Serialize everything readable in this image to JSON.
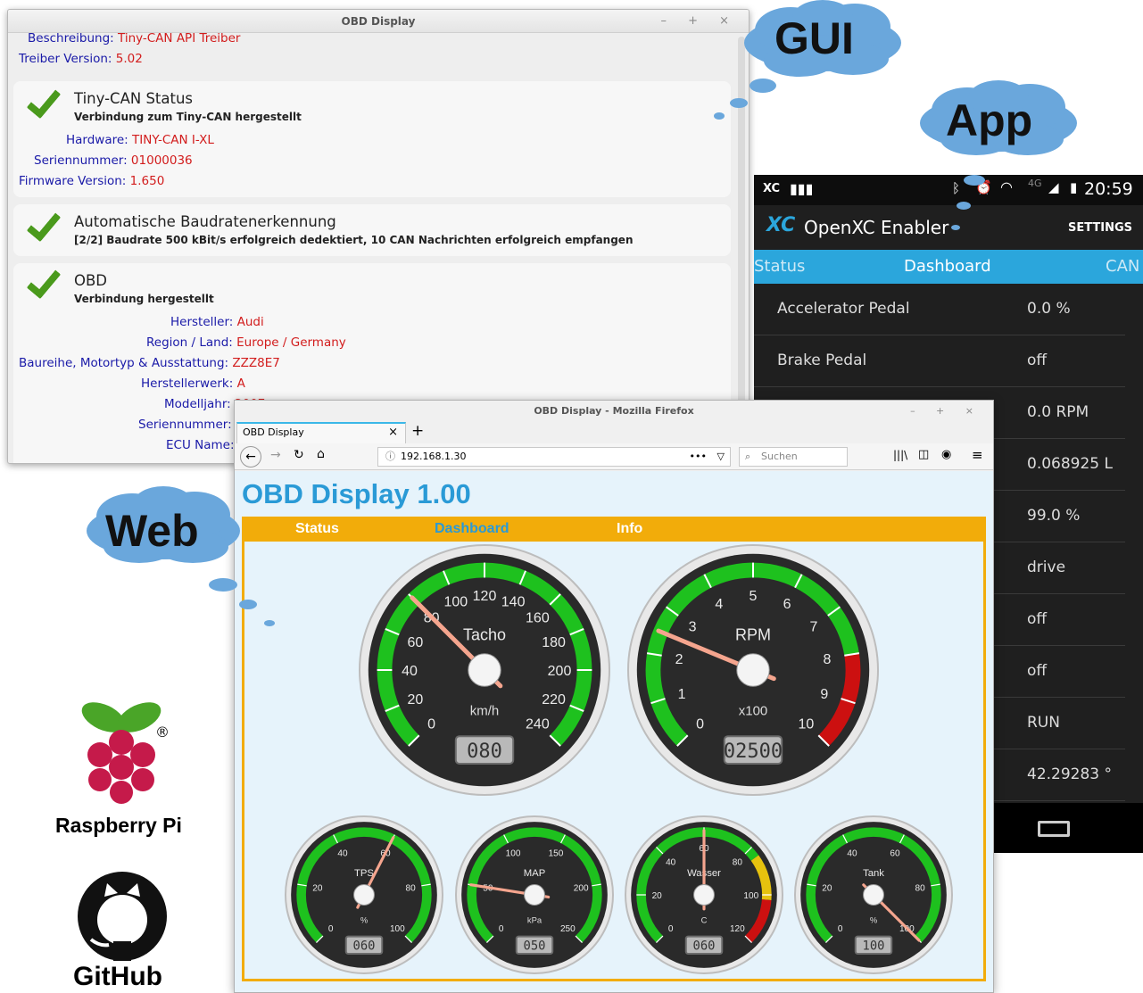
{
  "clouds": {
    "gui": "GUI",
    "app": "App",
    "web": "Web"
  },
  "logos": {
    "raspberry": "Raspberry Pi",
    "github": "GitHub"
  },
  "gui": {
    "title": "OBD Display",
    "top_rows": [
      {
        "key": "Beschreibung:",
        "value": "Tiny-CAN API Treiber"
      },
      {
        "key": "Treiber Version:",
        "value": "5.02"
      }
    ],
    "cards": [
      {
        "title": "Tiny-CAN Status",
        "subtitle": "Verbindung zum Tiny-CAN hergestellt",
        "rows": [
          {
            "key": "Hardware:",
            "value": "TINY-CAN I-XL"
          },
          {
            "key": "Seriennummer:",
            "value": "01000036"
          },
          {
            "key": "Firmware Version:",
            "value": "1.650"
          }
        ]
      },
      {
        "title": "Automatische Baudratenerkennung",
        "subtitle": "[2/2] Baudrate 500 kBit/s erfolgreich dedektiert, 10 CAN Nachrichten erfolgreich empfangen"
      },
      {
        "title": "OBD",
        "subtitle": "Verbindung hergestellt",
        "rows": [
          {
            "key": "Hersteller:",
            "value": "Audi"
          },
          {
            "key": "Region / Land:",
            "value": "Europe / Germany"
          },
          {
            "key": "Baureihe, Motortyp & Ausstattung:",
            "value": "ZZZ8E7"
          },
          {
            "key": "Herstellerwerk:",
            "value": "A"
          },
          {
            "key": "Modelljahr:",
            "value": "2007"
          },
          {
            "key": "Seriennummer:",
            "value": ""
          },
          {
            "key": "ECU Name:",
            "value": ""
          }
        ]
      }
    ]
  },
  "phone": {
    "status": {
      "carrier": "XC",
      "network": "4G",
      "time": "20:59"
    },
    "app_title": "OpenXC Enabler",
    "settings": "SETTINGS",
    "tabs": [
      "Status",
      "Dashboard",
      "CAN"
    ],
    "rows": [
      {
        "label": "Accelerator Pedal",
        "value": "0.0 %"
      },
      {
        "label": "Brake Pedal",
        "value": "off"
      },
      {
        "label": "",
        "value": "0.0 RPM"
      },
      {
        "label": "",
        "value": "0.068925 L"
      },
      {
        "label": "",
        "value": "99.0 %"
      },
      {
        "label": "",
        "value": "drive"
      },
      {
        "label": "",
        "value": "off"
      },
      {
        "label": "",
        "value": "off"
      },
      {
        "label": "",
        "value": "RUN"
      },
      {
        "label": "",
        "value": "42.29283 °"
      }
    ]
  },
  "firefox": {
    "window_title": "OBD Display - Mozilla Firefox",
    "tab_title": "OBD Display",
    "url": "192.168.1.30",
    "search_placeholder": "Suchen",
    "page": {
      "title": "OBD Display 1.00",
      "menu": [
        "Status",
        "Dashboard",
        "Info"
      ],
      "colors": {
        "menu_bg": "#f2ac0a",
        "menu_active": "#2a9ad6",
        "title": "#2a9ad6"
      }
    }
  },
  "gauges": {
    "tacho": {
      "label": "Tacho",
      "unit": "km/h",
      "ticks": [
        "0",
        "20",
        "40",
        "60",
        "80",
        "100",
        "120",
        "140",
        "160",
        "180",
        "200",
        "220",
        "240"
      ],
      "value": 80,
      "min": 0,
      "max": 240,
      "display": "080"
    },
    "rpm": {
      "label": "RPM",
      "unit": "x100",
      "ticks": [
        "0",
        "1",
        "2",
        "3",
        "4",
        "5",
        "6",
        "7",
        "8",
        "9",
        "10"
      ],
      "value": 25,
      "min": 0,
      "max": 100,
      "display": "02500"
    },
    "tps": {
      "label": "TPS",
      "unit": "%",
      "ticks": [
        "0",
        "20",
        "40",
        "60",
        "80",
        "100"
      ],
      "value": 60,
      "min": 0,
      "max": 100,
      "display": "060"
    },
    "map": {
      "label": "MAP",
      "unit": "kPa",
      "ticks": [
        "0",
        "50",
        "100",
        "150",
        "200",
        "250"
      ],
      "value": 50,
      "min": 0,
      "max": 250,
      "display": "050"
    },
    "wasser": {
      "label": "Wasser",
      "unit": "C",
      "ticks": [
        "0",
        "20",
        "40",
        "60",
        "80",
        "100",
        "120"
      ],
      "value": 60,
      "min": 0,
      "max": 120,
      "display": "060"
    },
    "tank": {
      "label": "Tank",
      "unit": "%",
      "ticks": [
        "0",
        "20",
        "40",
        "60",
        "80",
        "100"
      ],
      "value": 100,
      "min": 0,
      "max": 100,
      "display": "100"
    }
  }
}
